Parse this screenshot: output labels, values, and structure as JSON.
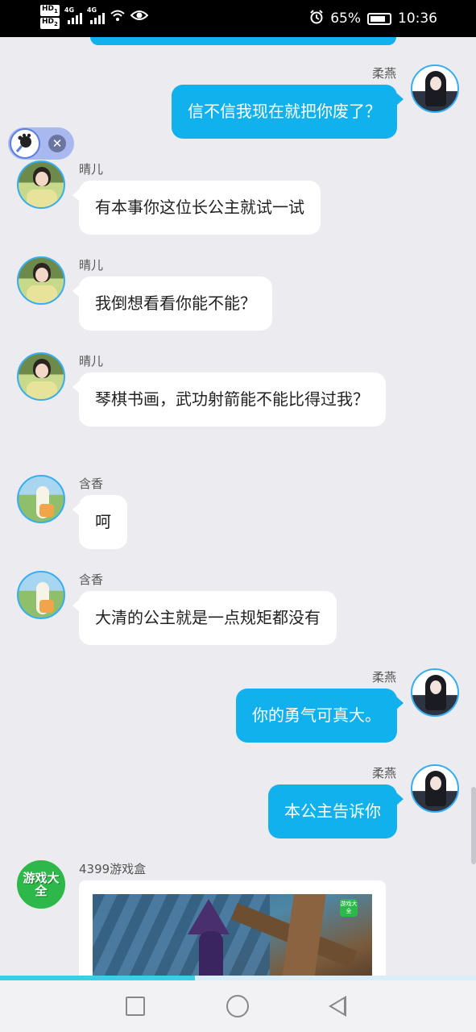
{
  "status_bar": {
    "hd1": "HD",
    "hd1_sub": "1",
    "hd2": "HD",
    "hd2_sub": "2",
    "net1": "4G",
    "net2": "4G",
    "battery": "65%",
    "time": "10:36"
  },
  "messages": [
    {
      "side": "right",
      "name": "柔燕",
      "avatar": "rouyan-avatar",
      "text": "信不信我现在就把你废了？"
    },
    {
      "side": "left",
      "name": "晴儿",
      "avatar": "qinger-avatar",
      "text": "有本事你这位长公主就试一试"
    },
    {
      "side": "left",
      "name": "晴儿",
      "avatar": "qinger-avatar",
      "text": "我倒想看看你能不能？"
    },
    {
      "side": "left",
      "name": "晴儿",
      "avatar": "qinger-avatar",
      "text": "琴棋书画，武功射箭能不能比得过我？"
    },
    {
      "side": "left",
      "name": "含香",
      "avatar": "hanxiang-avatar",
      "text": "呵"
    },
    {
      "side": "left",
      "name": "含香",
      "avatar": "hanxiang-avatar",
      "text": "大清的公主就是一点规矩都没有"
    },
    {
      "side": "right",
      "name": "柔燕",
      "avatar": "rouyan-avatar",
      "text": "你的勇气可真大。"
    },
    {
      "side": "right",
      "name": "柔燕",
      "avatar": "rouyan-avatar",
      "text": "本公主告诉你"
    },
    {
      "side": "left",
      "name": "4399游戏盒",
      "avatar": "game-box-avatar",
      "avatar_text": "游戏大全",
      "card": true
    }
  ],
  "card": {
    "logo_text": "游戏大全"
  },
  "float_widget": {
    "icon": "paw-magnifier-icon",
    "close": "✕"
  },
  "progress": 0.41
}
